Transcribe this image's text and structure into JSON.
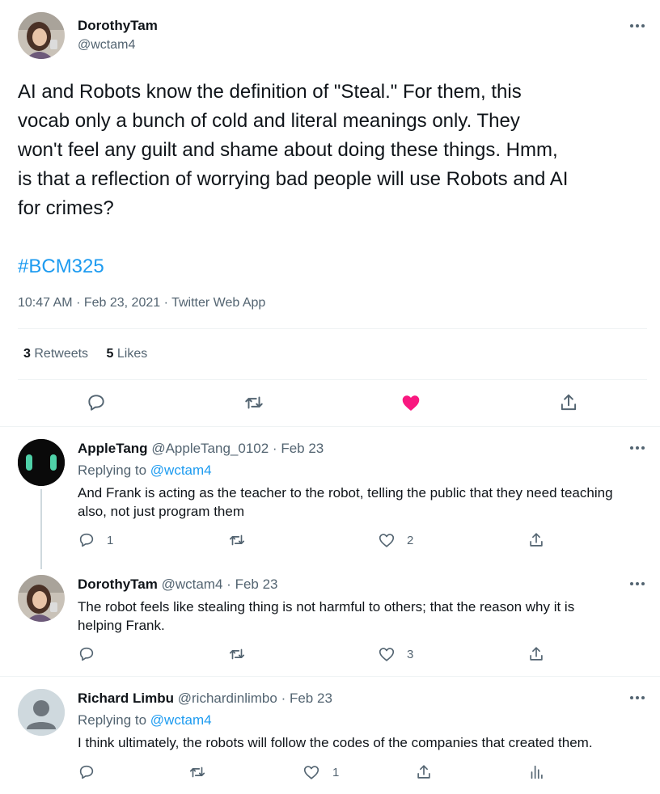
{
  "main_tweet": {
    "display_name": "DorothyTam",
    "handle": "@wctam4",
    "text_lines": [
      "AI and Robots know the definition of \"Steal.\" For them, this",
      "vocab only a bunch of cold and literal meanings only. They",
      "won't feel any guilt and shame about doing these things. Hmm,",
      "is that a reflection of worrying bad people will use Robots and AI",
      "for crimes?"
    ],
    "hashtag": "#BCM325",
    "time": "10:47 AM",
    "date": "Feb 23, 2021",
    "source": "Twitter Web App",
    "retweets_count": "3",
    "retweets_label": "Retweets",
    "likes_count": "5",
    "likes_label": "Likes",
    "liked": true
  },
  "replies": [
    {
      "display_name": "AppleTang",
      "handle": "@AppleTang_0102",
      "date": "Feb 23",
      "replying_prefix": "Replying to",
      "replying_to": "@wctam4",
      "text_lines": [
        "And Frank is acting as the teacher to the robot, telling the public that they need teaching",
        "also, not just program them"
      ],
      "reply_count": "1",
      "retweet_count": "",
      "like_count": "2"
    },
    {
      "display_name": "DorothyTam",
      "handle": "@wctam4",
      "date": "Feb 23",
      "text_lines": [
        "The robot feels like stealing thing is not harmful to others; that the reason why it is",
        "helping Frank."
      ],
      "reply_count": "",
      "retweet_count": "",
      "like_count": "3"
    },
    {
      "display_name": "Richard Limbu",
      "handle": "@richardinlimbo",
      "date": "Feb 23",
      "replying_prefix": "Replying to",
      "replying_to": "@wctam4",
      "text_lines": [
        "I think ultimately, the robots will follow the codes of the companies that created them."
      ],
      "reply_count": "",
      "retweet_count": "",
      "like_count": "1"
    }
  ],
  "separator": "·",
  "colors": {
    "like_active": "#f91880",
    "link": "#1d9bf0",
    "muted": "#536471"
  }
}
